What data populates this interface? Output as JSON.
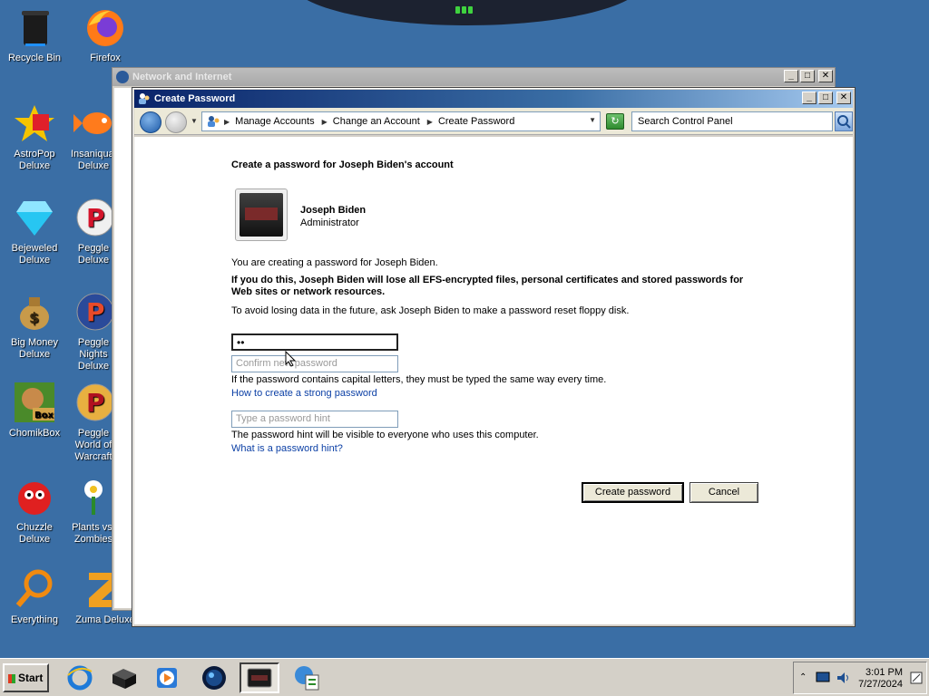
{
  "desktop": {
    "icons": [
      {
        "label": "Recycle Bin"
      },
      {
        "label": "Firefox"
      },
      {
        "label": "AstroPop Deluxe"
      },
      {
        "label": "Insaniquarium Deluxe"
      },
      {
        "label": "Bejeweled Deluxe"
      },
      {
        "label": "Peggle Deluxe"
      },
      {
        "label": "Big Money Deluxe"
      },
      {
        "label": "Peggle Nights Deluxe"
      },
      {
        "label": "ChomikBox"
      },
      {
        "label": "Peggle World of Warcraft"
      },
      {
        "label": "Chuzzle Deluxe"
      },
      {
        "label": "Plants vs. Zombies"
      },
      {
        "label": "Everything"
      },
      {
        "label": "Zuma Deluxe"
      }
    ]
  },
  "back_window": {
    "title": "Network and Internet"
  },
  "window": {
    "title": "Create Password",
    "controls": {
      "minimize": "_",
      "maximize": "□",
      "close": "✕"
    }
  },
  "addressbar": {
    "crumbs": [
      "Manage Accounts",
      "Change an Account",
      "Create Password"
    ],
    "search_placeholder": "Search Control Panel"
  },
  "content": {
    "heading": "Create a password for Joseph Biden's account",
    "user_name": "Joseph Biden",
    "user_role": "Administrator",
    "intro": "You are creating a password for Joseph Biden.",
    "warning": "If you do this, Joseph Biden will lose all EFS-encrypted files, personal certificates and stored passwords for Web sites or network resources.",
    "advice": "To avoid losing data in the future, ask Joseph Biden to make a password reset floppy disk.",
    "password_value": "••",
    "confirm_placeholder": "Confirm new password",
    "case_note": "If the password contains capital letters, they must be typed the same way every time.",
    "strong_link": "How to create a strong password",
    "hint_placeholder": "Type a password hint",
    "hint_note": "The password hint will be visible to everyone who uses this computer.",
    "hint_link": "What is a password hint?",
    "create_button": "Create password",
    "cancel_button": "Cancel"
  },
  "taskbar": {
    "start_label": "Start",
    "time": "3:01 PM",
    "date": "7/27/2024"
  }
}
